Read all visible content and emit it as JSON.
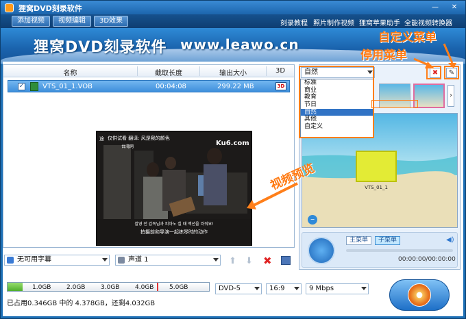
{
  "window": {
    "title": "狸窝DVD刻录软件"
  },
  "toolbar": {
    "buttons": [
      "添加视频",
      "视频编辑",
      "3D效果"
    ],
    "links": [
      "刻录教程",
      "照片制作视频",
      "狸窝苹果助手",
      "全能视频转换器"
    ]
  },
  "banner": {
    "brand": "狸窝DVD刻录软件",
    "url": "www.leawo.cn"
  },
  "video_list": {
    "columns": [
      "名称",
      "截取长度",
      "输出大小",
      "3D"
    ],
    "rows": [
      {
        "name": "VTS_01_1.VOB",
        "length": "00:04:08",
        "size": "299.22 MB",
        "three_d": "3D",
        "checked": true
      }
    ]
  },
  "video_frame": {
    "top_caption": "仅供试看   翻译: 风是我的颜色",
    "top_caption_left": "途",
    "top_caption_sub": "台湾网",
    "watermark": "Ku6.com",
    "subtitle_line1": "촬영 전 감독님과 피아노 칠 때 액션을 러워요!",
    "subtitle_line2": "拍摄前和导演一起练琴时的动作"
  },
  "bottom_tools": {
    "subtitle": "无可用字幕",
    "audio": "声道 1"
  },
  "storage": {
    "ticks": [
      "1.0GB",
      "2.0GB",
      "3.0GB",
      "4.0GB",
      "5.0GB"
    ],
    "used_fraction": 0.075,
    "limit_gb": 4.378,
    "status": "已占用0.346GB 中的 4.378GB，还剩4.032GB"
  },
  "disc_options": {
    "disc": "DVD-5",
    "aspect": "16:9",
    "bitrate": "9 Mbps"
  },
  "menu": {
    "category_selected": "自然",
    "categories": [
      "标准",
      "商业",
      "教育",
      "节日",
      "自然",
      "其他",
      "自定义"
    ],
    "preview_title": "VTS_01_1",
    "main_menu_label": "主菜单",
    "sub_menu_label": "子菜单",
    "time": "00:00:00/00:00:00"
  },
  "annotations": {
    "custom_menu": "自定义菜单",
    "disable_menu": "停用菜单",
    "video_preview": "视频预览"
  },
  "colors": {
    "accent": "#ff7f1a",
    "selection": "#3173c5",
    "brand_blue": "#1d6fb5"
  }
}
